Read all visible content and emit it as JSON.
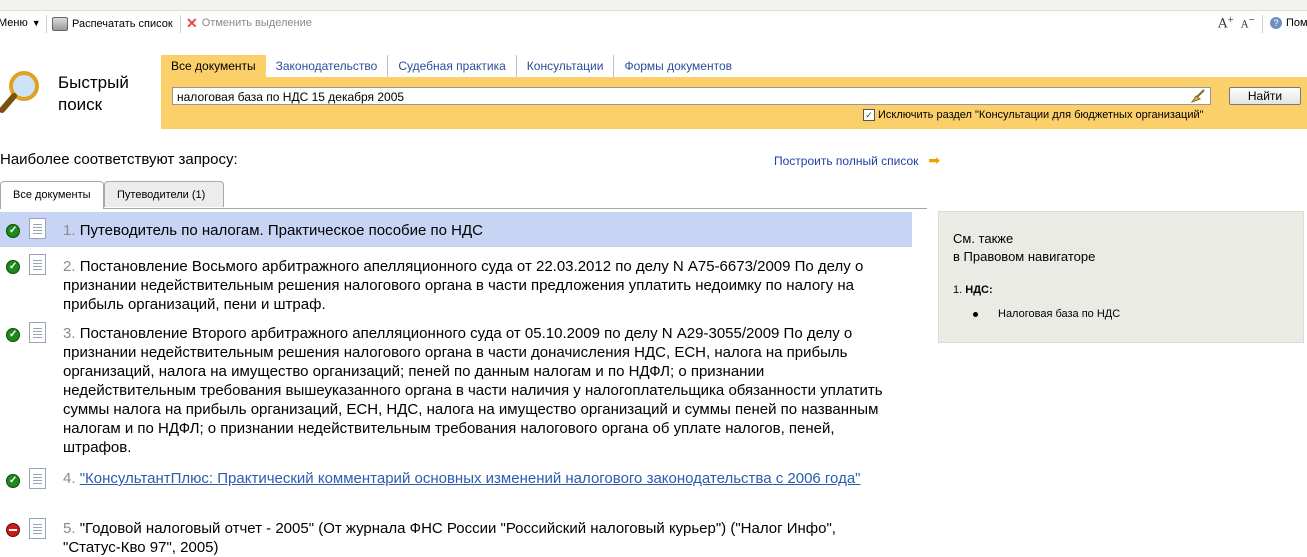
{
  "toolbar": {
    "menu_label": "Меню",
    "print_label": "Распечатать список",
    "cancel_label": "Отменить выделение",
    "font_increase": "A",
    "font_decrease": "A",
    "help_label": "Пом"
  },
  "logo": {
    "title_line1": "Быстрый",
    "title_line2": "поиск"
  },
  "tabs": [
    {
      "label": "Все документы",
      "active": true
    },
    {
      "label": "Законодательство",
      "active": false
    },
    {
      "label": "Судебная практика",
      "active": false
    },
    {
      "label": "Консультации",
      "active": false
    },
    {
      "label": "Формы документов",
      "active": false
    }
  ],
  "search": {
    "query": "налоговая база по НДС 15 декабря 2005",
    "find_button": "Найти",
    "exclude_label": "Исключить раздел \"Консультации для бюджетных организаций\"",
    "exclude_checked": true
  },
  "results_header": {
    "best_match": "Наиболее соответствуют запросу:",
    "build_full_list": "Построить полный список"
  },
  "result_tabs": [
    {
      "label": "Все документы",
      "active": true
    },
    {
      "label": "Путеводители (1)",
      "active": false
    }
  ],
  "results": [
    {
      "num": "1.",
      "title": "Путеводитель по налогам. Практическое пособие по НДС",
      "status": "ok",
      "selected": true,
      "link": false
    },
    {
      "num": "2.",
      "title": "Постановление Восьмого арбитражного апелляционного суда от 22.03.2012 по делу N А75-6673/2009 По делу о признании недействительным решения налогового органа в части предложения уплатить недоимку по налогу на прибыль организаций, пени и штраф.",
      "status": "ok",
      "selected": false,
      "link": false
    },
    {
      "num": "3.",
      "title": "Постановление Второго арбитражного апелляционного суда от 05.10.2009 по делу N А29-3055/2009 По делу о признании недействительным решения налогового органа в части доначисления НДС, ЕСН, налога на прибыль организаций, налога на имущество организаций; пеней по данным налогам и по НДФЛ; о признании недействительным требования вышеуказанного органа в части наличия у налогоплательщика обязанности уплатить суммы налога на прибыль организаций, ЕСН, НДС, налога на имущество организаций и суммы пеней по названным налогам и по НДФЛ; о признании недействительным требования налогового органа об уплате налогов, пеней, штрафов.",
      "status": "ok",
      "selected": false,
      "link": false
    },
    {
      "num": "4.",
      "title": "\"КонсультантПлюс: Практический комментарий основных изменений налогового законодательства с 2006 года\"",
      "status": "ok",
      "selected": false,
      "link": true
    },
    {
      "num": "5.",
      "title": "\"Годовой налоговый отчет - 2005\" (От журнала ФНС России \"Российский налоговый курьер\") (\"Налог Инфо\", \"Статус-Кво 97\", 2005)",
      "status": "stop",
      "selected": false,
      "link": false
    }
  ],
  "side_panel": {
    "title_line1": "См. также",
    "title_line2": "в Правовом навигаторе",
    "item_num": "1.",
    "item_label": "НДС:",
    "sub_item": "Налоговая база по НДС"
  }
}
